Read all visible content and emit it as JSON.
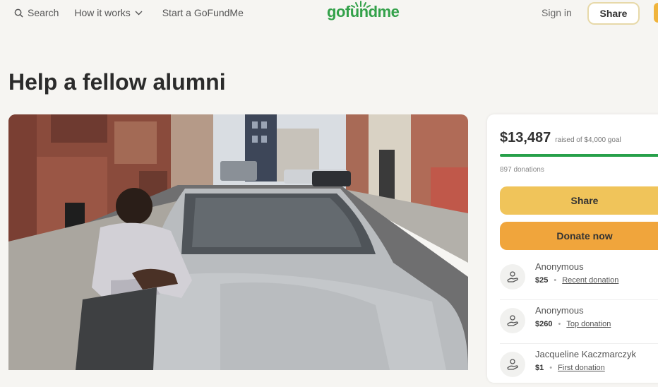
{
  "header": {
    "search_label": "Search",
    "how_it_works_label": "How it works",
    "start_label": "Start a GoFundMe",
    "logo_text": "gofundme",
    "signin_label": "Sign in",
    "share_label": "Share"
  },
  "campaign": {
    "title": "Help a fellow alumni"
  },
  "donation_card": {
    "raised_amount": "$13,487",
    "goal_text": "raised of $4,000 goal",
    "progress_fraction": 1.0,
    "donations_count": "897 donations",
    "share_button": "Share",
    "donate_button": "Donate now",
    "donors": [
      {
        "name": "Anonymous",
        "amount": "$25",
        "tag": "Recent donation"
      },
      {
        "name": "Anonymous",
        "amount": "$260",
        "tag": "Top donation"
      },
      {
        "name": "Jacqueline Kaczmarczyk",
        "amount": "$1",
        "tag": "First donation"
      }
    ]
  },
  "colors": {
    "brand_green": "#33a14a",
    "share_yellow": "#f0c45a",
    "donate_orange": "#f0a53c"
  }
}
